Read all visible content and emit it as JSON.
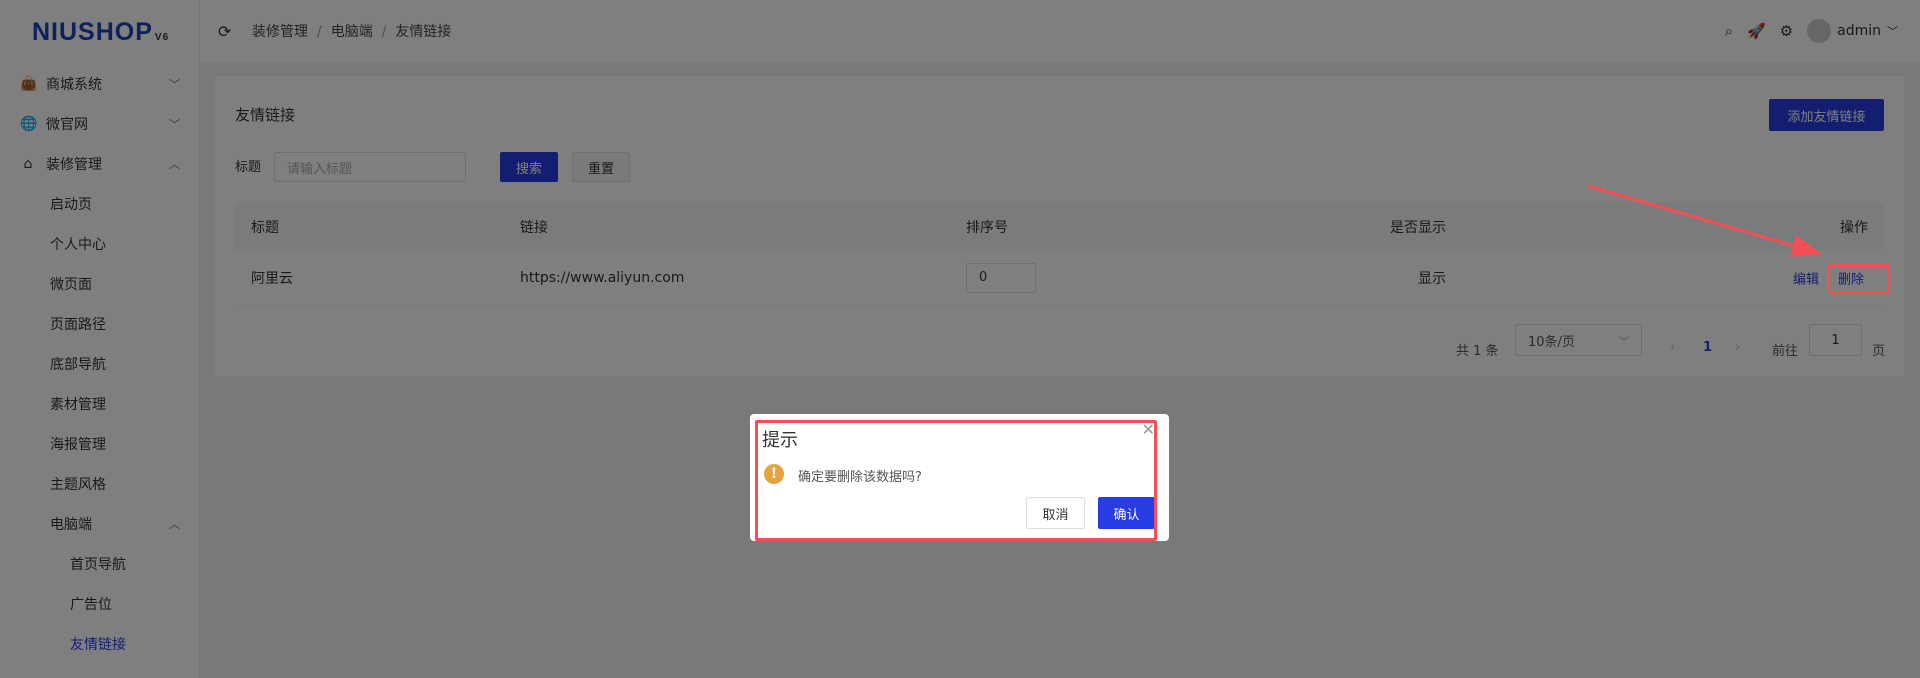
{
  "logo": {
    "text": "NIUSHOP",
    "version": "V6"
  },
  "sidebar": {
    "items": [
      {
        "label": "商城系统",
        "icon": "shopping-bag-icon",
        "chevron": "down"
      },
      {
        "label": "微官网",
        "icon": "globe-icon",
        "chevron": "down"
      },
      {
        "label": "装修管理",
        "icon": "decoration-icon",
        "chevron": "up"
      },
      {
        "label": "启动页"
      },
      {
        "label": "个人中心"
      },
      {
        "label": "微页面"
      },
      {
        "label": "页面路径"
      },
      {
        "label": "底部导航"
      },
      {
        "label": "素材管理"
      },
      {
        "label": "海报管理"
      },
      {
        "label": "主题风格"
      },
      {
        "label": "电脑端",
        "chevron": "up"
      },
      {
        "label": "首页导航"
      },
      {
        "label": "广告位"
      },
      {
        "label": "友情链接",
        "active": true
      }
    ]
  },
  "header": {
    "breadcrumb": [
      "装修管理",
      "电脑端",
      "友情链接"
    ],
    "separator": "/",
    "user": "admin"
  },
  "page": {
    "title": "友情链接",
    "add_button": "添加友情链接",
    "filter": {
      "label": "标题",
      "placeholder": "请输入标题",
      "search": "搜索",
      "reset": "重置"
    },
    "table": {
      "columns": [
        "标题",
        "链接",
        "排序号",
        "是否显示",
        "操作"
      ],
      "rows": [
        {
          "title": "阿里云",
          "url": "https://www.aliyun.com",
          "sort": "0",
          "show": "显示",
          "edit": "编辑",
          "delete": "删除"
        }
      ]
    },
    "pagination": {
      "total": "共 1 条",
      "page_size": "10条/页",
      "current": "1",
      "goto_label": "前往",
      "goto_value": "1",
      "page_suffix": "页"
    }
  },
  "dialog": {
    "title": "提示",
    "message": "确定要删除该数据吗?",
    "cancel": "取消",
    "confirm": "确认"
  },
  "colors": {
    "primary": "#273de3",
    "annotation": "#f25055",
    "warning": "#e6a23c"
  }
}
